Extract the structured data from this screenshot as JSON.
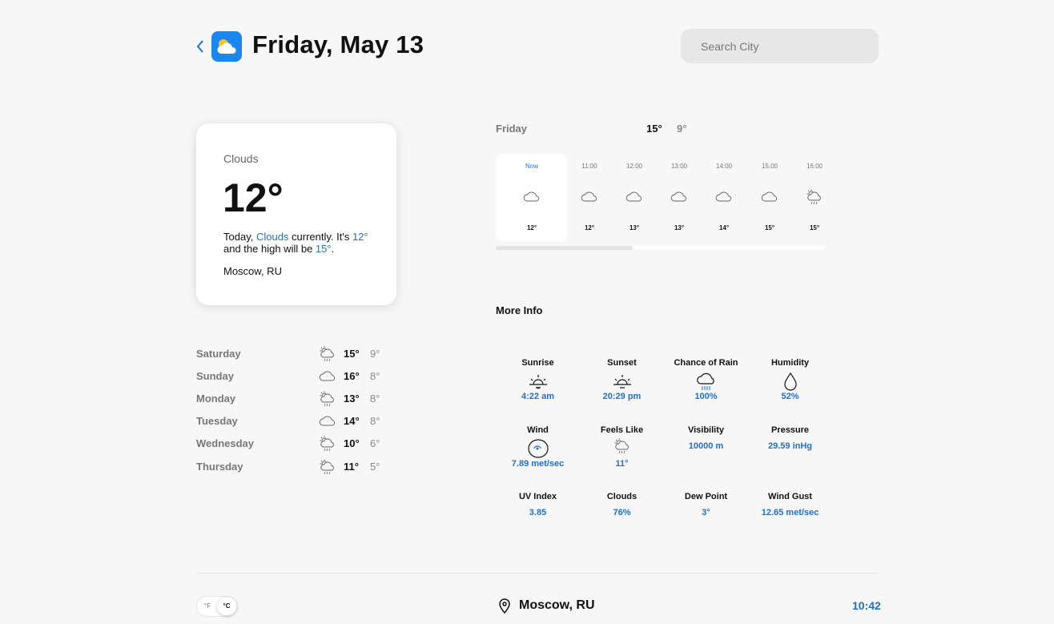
{
  "header": {
    "back_icon": "chevron-left-icon",
    "app_icon": "cloud-sun-icon",
    "title": "Friday, May 13",
    "search_placeholder": "Search City"
  },
  "current": {
    "condition": "Clouds",
    "temp": "12°",
    "desc_prefix": "Today, ",
    "desc_condition": "Clouds",
    "desc_mid": " currently. It's ",
    "desc_temp": "12°",
    "desc_mid2": " and the high will be ",
    "desc_high": "15°",
    "desc_end": ".",
    "location": "Moscow, RU"
  },
  "daily": [
    {
      "day": "Saturday",
      "icon": "cloud-rain-sun-icon",
      "hi": "15°",
      "lo": "9°"
    },
    {
      "day": "Sunday",
      "icon": "cloud-icon",
      "hi": "16°",
      "lo": "8°"
    },
    {
      "day": "Monday",
      "icon": "cloud-rain-sun-icon",
      "hi": "13°",
      "lo": "8°"
    },
    {
      "day": "Tuesday",
      "icon": "cloud-icon",
      "hi": "14°",
      "lo": "8°"
    },
    {
      "day": "Wednesday",
      "icon": "cloud-rain-sun-icon",
      "hi": "10°",
      "lo": "6°"
    },
    {
      "day": "Thursday",
      "icon": "cloud-rain-sun-icon",
      "hi": "11°",
      "lo": "5°"
    }
  ],
  "hourly_header": {
    "day": "Friday",
    "hi": "15°",
    "lo": "9°"
  },
  "hourly": [
    {
      "time": "Now",
      "icon": "cloud-icon",
      "temp": "12°"
    },
    {
      "time": "11:00",
      "icon": "cloud-icon",
      "temp": "12°"
    },
    {
      "time": "12:00",
      "icon": "cloud-icon",
      "temp": "13°"
    },
    {
      "time": "13:00",
      "icon": "cloud-icon",
      "temp": "13°"
    },
    {
      "time": "14:00",
      "icon": "cloud-icon",
      "temp": "14°"
    },
    {
      "time": "15:00",
      "icon": "cloud-icon",
      "temp": "15°"
    },
    {
      "time": "16:00",
      "icon": "cloud-rain-sun-icon",
      "temp": "15°"
    }
  ],
  "more_info": {
    "title": "More Info",
    "items": [
      {
        "label": "Sunrise",
        "icon": "sunrise-icon",
        "value": "4:22 am"
      },
      {
        "label": "Sunset",
        "icon": "sunset-icon",
        "value": "20:29 pm"
      },
      {
        "label": "Chance of Rain",
        "icon": "cloud-rain-icon",
        "value": "100%"
      },
      {
        "label": "Humidity",
        "icon": "droplet-icon",
        "value": "52%"
      },
      {
        "label": "Wind",
        "icon": "wind-icon",
        "value": "7.89 met/sec"
      },
      {
        "label": "Feels Like",
        "icon": "cloud-rain-sun-icon",
        "value": "11°"
      },
      {
        "label": "Visibility",
        "icon": "",
        "value": "10000 m"
      },
      {
        "label": "Pressure",
        "icon": "",
        "value": "29.59 inHg"
      },
      {
        "label": "UV Index",
        "icon": "",
        "value": "3.85"
      },
      {
        "label": "Clouds",
        "icon": "",
        "value": "76%"
      },
      {
        "label": "Dew Point",
        "icon": "",
        "value": "3°"
      },
      {
        "label": "Wind Gust",
        "icon": "",
        "value": "12.65 met/sec"
      }
    ]
  },
  "footer": {
    "unit_f": "°F",
    "unit_c": "°C",
    "selected_unit": "°C",
    "pin_icon": "map-pin-icon",
    "location": "Moscow, RU",
    "time": "10:42"
  },
  "colors": {
    "accent": "#1f6fd6",
    "app_icon_bg": "#1a86f0",
    "background": "#f7f7f7"
  }
}
